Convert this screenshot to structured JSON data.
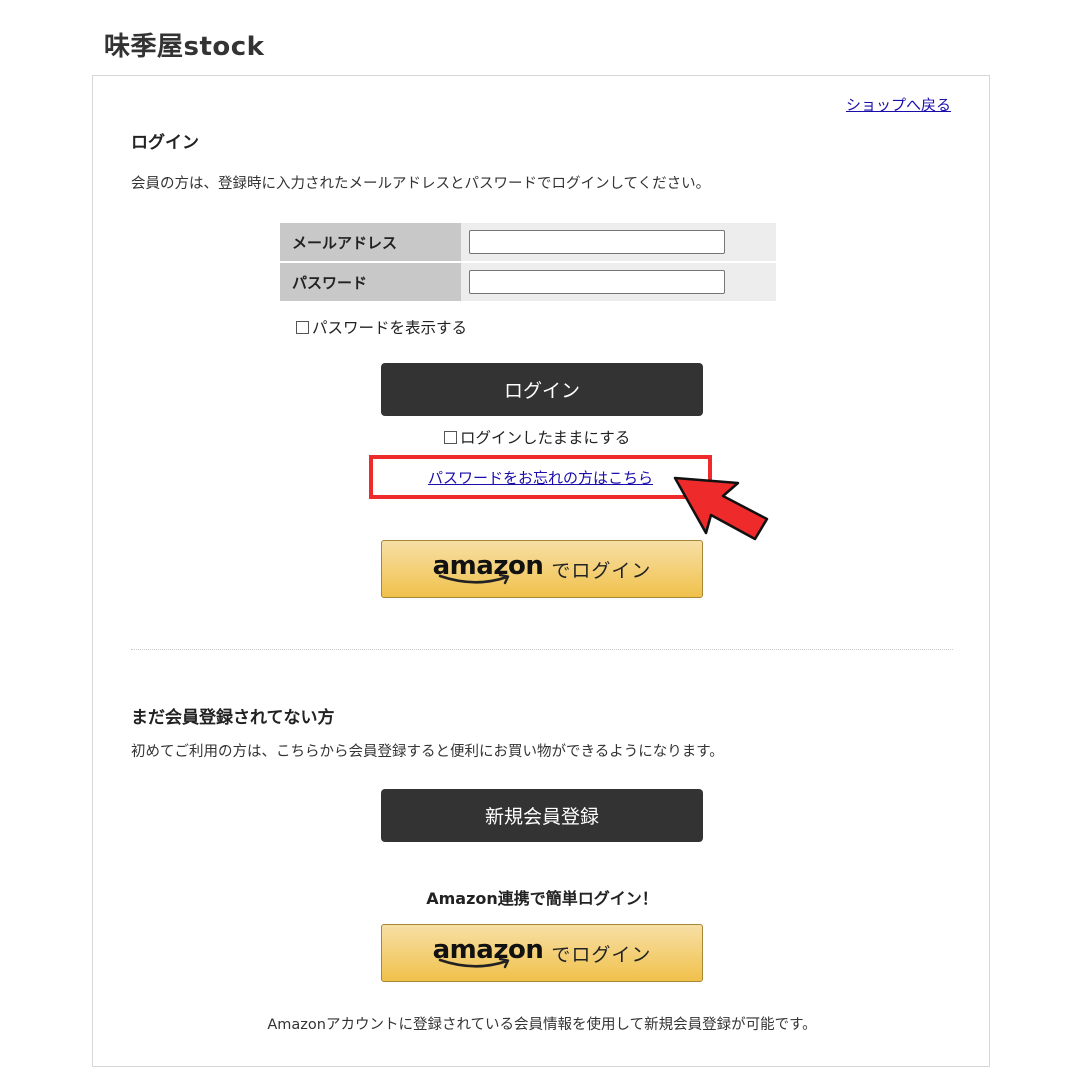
{
  "site": {
    "title": "味季屋stock"
  },
  "nav": {
    "back_link": "ショップへ戻る"
  },
  "login": {
    "heading": "ログイン",
    "description": "会員の方は、登録時に入力されたメールアドレスとパスワードでログインしてください。",
    "email_label": "メールアドレス",
    "email_value": "",
    "password_label": "パスワード",
    "password_value": "",
    "show_password_label": "パスワードを表示する",
    "show_password_checked": false,
    "submit_label": "ログイン",
    "remember_label": "ログインしたままにする",
    "remember_checked": false,
    "forgot_link": "パスワードをお忘れの方はこちら",
    "amazon_button": {
      "logo_text": "amazon",
      "suffix": "でログイン"
    }
  },
  "register": {
    "heading": "まだ会員登録されてない方",
    "description": "初めてご利用の方は、こちらから会員登録すると便利にお買い物ができるようになります。",
    "button_label": "新規会員登録",
    "amazon_heading": "Amazon連携で簡単ログイン！",
    "amazon_button": {
      "logo_text": "amazon",
      "suffix": "でログイン"
    },
    "amazon_note": "Amazonアカウントに登録されている会員情報を使用して新規会員登録が可能です。"
  },
  "colors": {
    "dark_button": "#333333",
    "link": "#1a0dab",
    "highlight": "#ee2a2a",
    "amazon_top": "#f7dfa5",
    "amazon_bottom": "#f0c14b"
  },
  "icons": {
    "annotation": "red-pointer-arrow-icon",
    "amazon": "amazon-smile-icon"
  }
}
